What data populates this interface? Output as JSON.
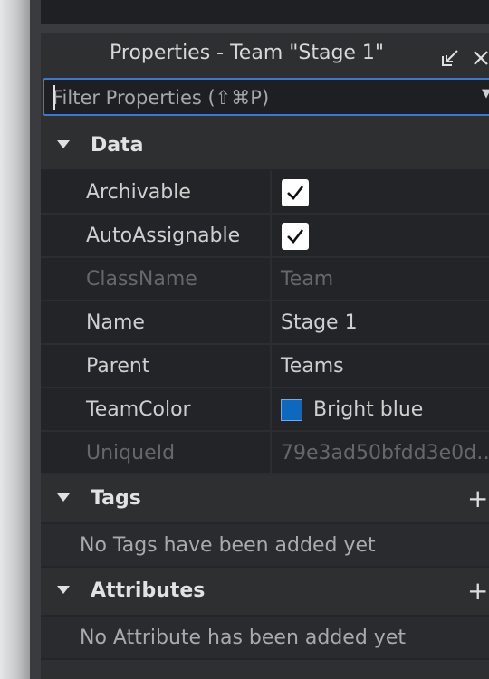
{
  "panel": {
    "title": "Properties - Team \"Stage 1\""
  },
  "filter": {
    "placeholder": "Filter Properties (⇧⌘P)"
  },
  "sections": {
    "data": {
      "label": "Data",
      "rows": {
        "archivable": {
          "name": "Archivable",
          "checked": true
        },
        "autoassignable": {
          "name": "AutoAssignable",
          "checked": true
        },
        "classname": {
          "name": "ClassName",
          "value": "Team"
        },
        "name": {
          "name": "Name",
          "value": "Stage 1"
        },
        "parent": {
          "name": "Parent",
          "value": "Teams"
        },
        "teamcolor": {
          "name": "TeamColor",
          "value": "Bright blue",
          "swatch": "#0d68c0"
        },
        "uniqueid": {
          "name": "UniqueId",
          "value": "79e3ad50bfdd3e0d…"
        }
      }
    },
    "tags": {
      "label": "Tags",
      "add_label": "+",
      "empty_message": "No Tags have been added yet"
    },
    "attributes": {
      "label": "Attributes",
      "add_label": "+",
      "empty_message": "No Attribute has been added yet"
    }
  },
  "colors": {
    "accent": "#3c78d0",
    "background": "#2e2f31",
    "row_background": "#232427"
  }
}
